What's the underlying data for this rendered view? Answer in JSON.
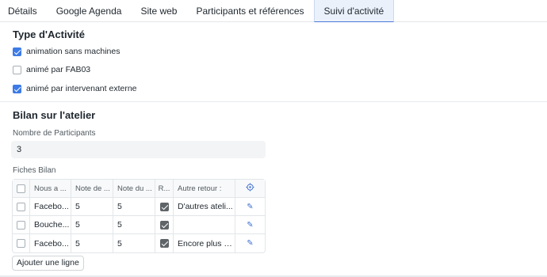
{
  "tabs": [
    "Détails",
    "Google Agenda",
    "Site web",
    "Participants et références",
    "Suivi d'activité"
  ],
  "activity": {
    "title": "Type d'Activité",
    "options": [
      {
        "label": "animation sans machines",
        "checked": true
      },
      {
        "label": "animé par FAB03",
        "checked": false
      },
      {
        "label": "animé par intervenant externe",
        "checked": true
      }
    ]
  },
  "bilan": {
    "title": "Bilan sur l'atelier",
    "participants_label": "Nombre de Participants",
    "participants_value": "3",
    "fiches_label": "Fiches Bilan",
    "columns": [
      "Nous a ...",
      "Note de ...",
      "Note du ...",
      "R...",
      "Autre retour :"
    ],
    "rows": [
      {
        "c1": "Facebo...",
        "c2": "5",
        "c3": "5",
        "r": true,
        "other": "D'autres ateli..."
      },
      {
        "c1": "Bouche...",
        "c2": "5",
        "c3": "5",
        "r": true,
        "other": ""
      },
      {
        "c1": "Facebo...",
        "c2": "5",
        "c3": "5",
        "r": true,
        "other": "Encore plus d..."
      }
    ],
    "add_row_label": "Ajouter une ligne"
  },
  "colors": {
    "accent": "#3d7be6",
    "tab_active_bg": "#ebf1fb"
  },
  "icons": {
    "header_settings": "settings-icon",
    "row_edit": "edit-icon"
  }
}
